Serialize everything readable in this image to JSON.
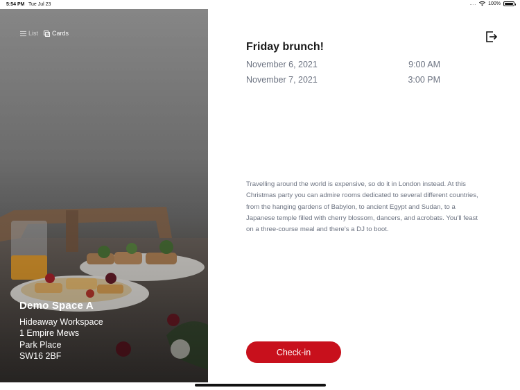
{
  "status_bar": {
    "time": "5:54 PM",
    "date": "Tue Jul 23",
    "signal": "....",
    "battery": "100%"
  },
  "left_panel": {
    "view_toggle": {
      "list_label": "List",
      "cards_label": "Cards",
      "active": "Cards"
    },
    "space": {
      "name": "Demo Space A",
      "address": [
        "Hideaway Workspace",
        "1 Empire Mews",
        "Park Place",
        "SW16 2BF"
      ]
    }
  },
  "event": {
    "title": "Friday brunch!",
    "start": {
      "date": "November 6, 2021",
      "time": "9:00 AM"
    },
    "end": {
      "date": "November 7, 2021",
      "time": "3:00 PM"
    },
    "description": "Travelling around the world is expensive, so do it in London instead. At this Christmas party you can admire rooms dedicated to several different countries, from the hanging gardens of Babylon, to ancient Egypt and Sudan, to a Japanese temple filled with cherry blossom, dancers, and acrobats. You'll feast on a three-course meal and there's a DJ to boot."
  },
  "actions": {
    "checkin_label": "Check-in"
  },
  "colors": {
    "accent": "#c8101c",
    "secondary_text": "#6b7280"
  },
  "icons": {
    "logout": "logout-icon",
    "list": "list-icon",
    "cards": "cards-icon",
    "wifi": "wifi-icon",
    "battery": "battery-icon"
  }
}
